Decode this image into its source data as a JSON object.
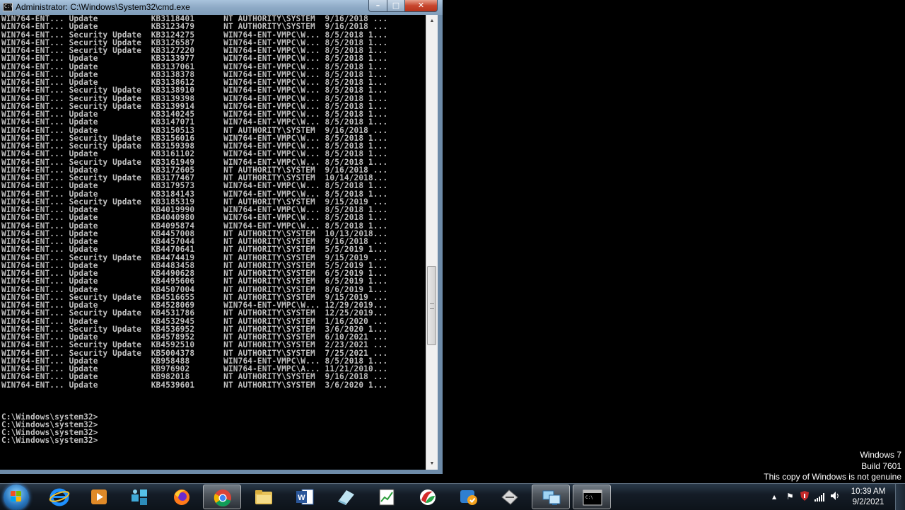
{
  "window": {
    "title": "Administrator: C:\\Windows\\System32\\cmd.exe",
    "icon_text": "C:\\",
    "min_label": "–",
    "max_label": "□",
    "close_label": "✕"
  },
  "console_lines": [
    "WIN764-ENT... Update           KB3118401      NT AUTHORITY\\SYSTEM  9/16/2018 ...",
    "WIN764-ENT... Update           KB3123479      NT AUTHORITY\\SYSTEM  9/16/2018 ...",
    "WIN764-ENT... Security Update  KB3124275      WIN764-ENT-VMPC\\W... 8/5/2018 1...",
    "WIN764-ENT... Security Update  KB3126587      WIN764-ENT-VMPC\\W... 8/5/2018 1...",
    "WIN764-ENT... Security Update  KB3127220      WIN764-ENT-VMPC\\W... 8/5/2018 1...",
    "WIN764-ENT... Update           KB3133977      WIN764-ENT-VMPC\\W... 8/5/2018 1...",
    "WIN764-ENT... Update           KB3137061      WIN764-ENT-VMPC\\W... 8/5/2018 1...",
    "WIN764-ENT... Update           KB3138378      WIN764-ENT-VMPC\\W... 8/5/2018 1...",
    "WIN764-ENT... Update           KB3138612      WIN764-ENT-VMPC\\W... 8/5/2018 1...",
    "WIN764-ENT... Security Update  KB3138910      WIN764-ENT-VMPC\\W... 8/5/2018 1...",
    "WIN764-ENT... Security Update  KB3139398      WIN764-ENT-VMPC\\W... 8/5/2018 1...",
    "WIN764-ENT... Security Update  KB3139914      WIN764-ENT-VMPC\\W... 8/5/2018 1...",
    "WIN764-ENT... Update           KB3140245      WIN764-ENT-VMPC\\W... 8/5/2018 1...",
    "WIN764-ENT... Update           KB3147071      WIN764-ENT-VMPC\\W... 8/5/2018 1...",
    "WIN764-ENT... Update           KB3150513      NT AUTHORITY\\SYSTEM  9/16/2018 ...",
    "WIN764-ENT... Security Update  KB3156016      WIN764-ENT-VMPC\\W... 8/5/2018 1...",
    "WIN764-ENT... Security Update  KB3159398      WIN764-ENT-VMPC\\W... 8/5/2018 1...",
    "WIN764-ENT... Update           KB3161102      WIN764-ENT-VMPC\\W... 8/5/2018 1...",
    "WIN764-ENT... Security Update  KB3161949      WIN764-ENT-VMPC\\W... 8/5/2018 1...",
    "WIN764-ENT... Update           KB3172605      NT AUTHORITY\\SYSTEM  9/16/2018 ...",
    "WIN764-ENT... Security Update  KB3177467      NT AUTHORITY\\SYSTEM  10/14/2018...",
    "WIN764-ENT... Update           KB3179573      WIN764-ENT-VMPC\\W... 8/5/2018 1...",
    "WIN764-ENT... Update           KB3184143      WIN764-ENT-VMPC\\W... 8/5/2018 1...",
    "WIN764-ENT... Security Update  KB3185319      NT AUTHORITY\\SYSTEM  9/15/2019 ...",
    "WIN764-ENT... Update           KB4019990      WIN764-ENT-VMPC\\W... 8/5/2018 1...",
    "WIN764-ENT... Update           KB4040980      WIN764-ENT-VMPC\\W... 8/5/2018 1...",
    "WIN764-ENT... Update           KB4095874      WIN764-ENT-VMPC\\W... 8/5/2018 1...",
    "WIN764-ENT... Update           KB4457008      NT AUTHORITY\\SYSTEM  10/13/2018...",
    "WIN764-ENT... Update           KB4457044      NT AUTHORITY\\SYSTEM  9/16/2018 ...",
    "WIN764-ENT... Update           KB4470641      NT AUTHORITY\\SYSTEM  5/5/2019 1...",
    "WIN764-ENT... Security Update  KB4474419      NT AUTHORITY\\SYSTEM  9/15/2019 ...",
    "WIN764-ENT... Update           KB4483458      NT AUTHORITY\\SYSTEM  5/5/2019 1...",
    "WIN764-ENT... Update           KB4490628      NT AUTHORITY\\SYSTEM  6/5/2019 1...",
    "WIN764-ENT... Update           KB4495606      NT AUTHORITY\\SYSTEM  6/5/2019 1...",
    "WIN764-ENT... Update           KB4507004      NT AUTHORITY\\SYSTEM  8/6/2019 1...",
    "WIN764-ENT... Security Update  KB4516655      NT AUTHORITY\\SYSTEM  9/15/2019 ...",
    "WIN764-ENT... Update           KB4528069      WIN764-ENT-VMPC\\W... 12/29/2019...",
    "WIN764-ENT... Security Update  KB4531786      NT AUTHORITY\\SYSTEM  12/25/2019...",
    "WIN764-ENT... Update           KB4532945      NT AUTHORITY\\SYSTEM  1/16/2020 ...",
    "WIN764-ENT... Security Update  KB4536952      NT AUTHORITY\\SYSTEM  3/6/2020 1...",
    "WIN764-ENT... Update           KB4578952      NT AUTHORITY\\SYSTEM  6/10/2021 ...",
    "WIN764-ENT... Security Update  KB4592510      NT AUTHORITY\\SYSTEM  2/23/2021 ...",
    "WIN764-ENT... Security Update  KB5004378      NT AUTHORITY\\SYSTEM  7/25/2021 ...",
    "WIN764-ENT... Update           KB958488       WIN764-ENT-VMPC\\W... 8/5/2018 1...",
    "WIN764-ENT... Update           KB976902       WIN764-ENT-VMPC\\A... 11/21/2010...",
    "WIN764-ENT... Update           KB982018       NT AUTHORITY\\SYSTEM  9/16/2018 ...",
    "WIN764-ENT... Update           KB4539601      NT AUTHORITY\\SYSTEM  3/6/2020 1...",
    "",
    "",
    "",
    "C:\\Windows\\system32>",
    "C:\\Windows\\system32>",
    "C:\\Windows\\system32>",
    "C:\\Windows\\system32>"
  ],
  "scrollbar": {
    "up_arrow": "▲",
    "down_arrow": "▼",
    "thumb_position_fraction": 0.68
  },
  "watermark": {
    "line1": "Windows 7",
    "line2": "Build 7601",
    "line3": "This copy of Windows is not genuine"
  },
  "taskbar": {
    "pinned": [
      {
        "name": "internet-explorer-icon"
      },
      {
        "name": "media-player-icon"
      },
      {
        "name": "network-app-icon"
      },
      {
        "name": "firefox-icon"
      },
      {
        "name": "chrome-icon"
      },
      {
        "name": "file-explorer-icon"
      },
      {
        "name": "word-icon"
      },
      {
        "name": "eraser-app-icon"
      },
      {
        "name": "chart-app-icon"
      },
      {
        "name": "red-green-app-icon"
      },
      {
        "name": "email-app-icon"
      },
      {
        "name": "tool-app-icon"
      },
      {
        "name": "remote-desktop-icon"
      },
      {
        "name": "cmd-icon"
      }
    ],
    "cmd_icon_text": "C:\\",
    "tray": {
      "arrow": "▲",
      "flag": "⚑",
      "signal": "▐",
      "speaker": "🔈"
    },
    "clock": {
      "time": "10:39 AM",
      "date": "9/2/2021"
    }
  },
  "colors": {
    "console_text": "#c0c0c0",
    "console_bg": "#000000",
    "titlebar": "#8eaac6",
    "close_button": "#c7452d"
  }
}
